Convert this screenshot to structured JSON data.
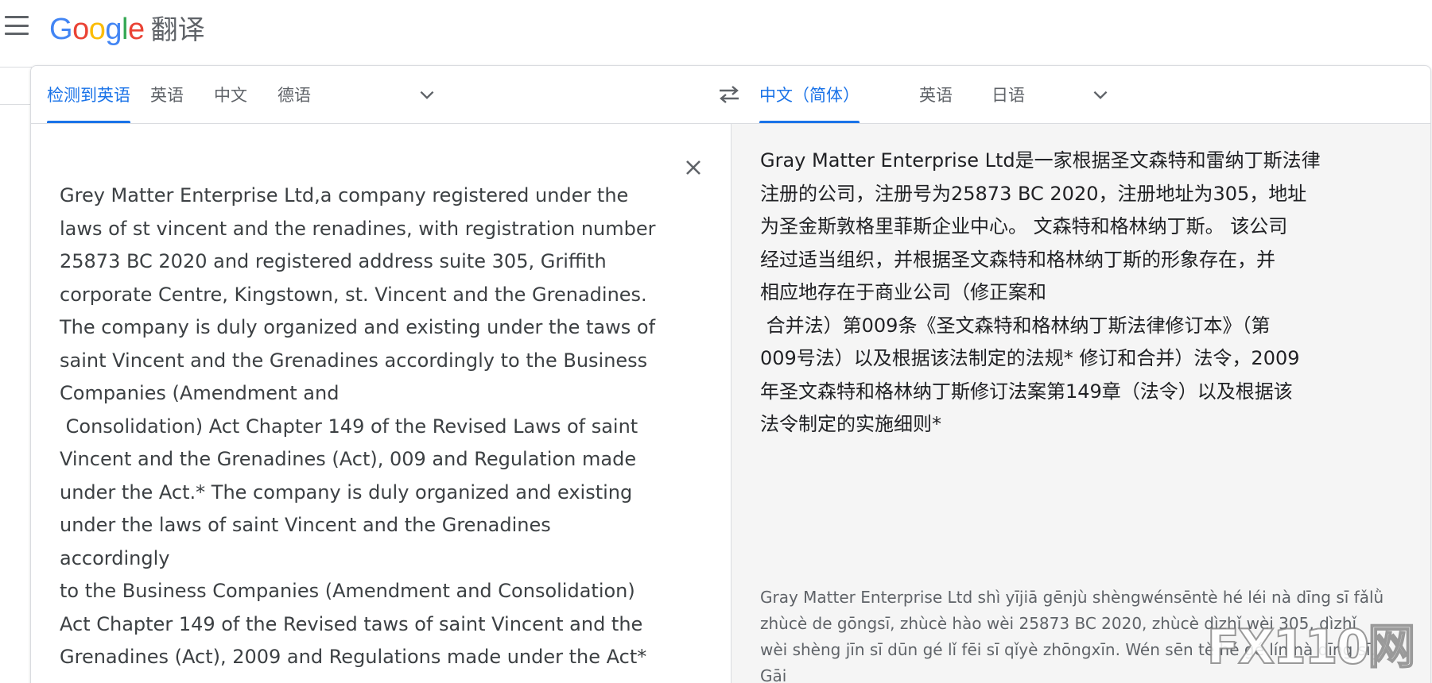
{
  "header": {
    "logo_text": "Google",
    "product_name": "翻译"
  },
  "brand_colors": {
    "blue": "#4285F4",
    "red": "#EA4335",
    "yellow": "#FBBC05",
    "green": "#34A853",
    "accent": "#1a73e8"
  },
  "source_langs": {
    "tabs": [
      {
        "label": "检测到英语",
        "active": true
      },
      {
        "label": "英语",
        "active": false
      },
      {
        "label": "中文",
        "active": false
      },
      {
        "label": "德语",
        "active": false
      }
    ]
  },
  "target_langs": {
    "tabs": [
      {
        "label": "中文（简体）",
        "active": true
      },
      {
        "label": "英语",
        "active": false
      },
      {
        "label": "日语",
        "active": false
      }
    ]
  },
  "icons": {
    "menu": "menu-icon",
    "swap": "swap-languages-icon",
    "chevron": "chevron-down-icon",
    "close": "close-icon"
  },
  "source": {
    "text": "Grey Matter Enterprise Ltd,a company registered under the\nlaws of st vincent and the renadines, with registration number\n25873 BC 2020 and registered address suite 305, Griffith\ncorporate Centre, Kingstown, st. Vincent and the Grenadines.\nThe company is duly organized and existing under the taws of\nsaint Vincent and the Grenadines accordingly to the Business\nCompanies (Amendment and\n Consolidation) Act Chapter 149 of the Revised Laws of saint\nVincent and the Grenadines (Act), 009 and Regulation made\nunder the Act.* The company is duly organized and existing\nunder the laws of saint Vincent and the Grenadines accordingly\nto the Business Companies (Amendment and Consolidation)\nAct Chapter 149 of the Revised taws of saint Vincent and the\nGrenadines (Act), 2009 and Regulations made under the Act*"
  },
  "target": {
    "text": "Gray Matter Enterprise Ltd是一家根据圣文森特和雷纳丁斯法律\n注册的公司，注册号为25873 BC 2020，注册地址为305，地址\n为圣金斯敦格里菲斯企业中心。 文森特和格林纳丁斯。 该公司\n经过适当组织，并根据圣文森特和格林纳丁斯的形象存在，并\n相应地存在于商业公司（修正案和\n 合并法）第009条《圣文森特和格林纳丁斯法律修订本》（第\n009号法）以及根据该法制定的法规* 修订和合并）法令，2009\n年圣文森特和格林纳丁斯修订法案第149章（法令）以及根据该\n法令制定的实施细则*",
    "romanization": "Gray Matter Enterprise Ltd shì yījiā gēnjù shèngwénsēntè hé léi nà dīng sī fǎlǜ zhùcè de gōngsī, zhùcè hào wèi 25873 BC 2020, zhùcè dìzhǐ wèi 305, dìzhǐ wèi shèng jīn sī dūn gé lǐ fēi sī qǐyè zhōngxīn. Wén sēn tè hé gé lín nà dīng sī. Gāi"
  },
  "watermark": {
    "text": "FX110网"
  }
}
